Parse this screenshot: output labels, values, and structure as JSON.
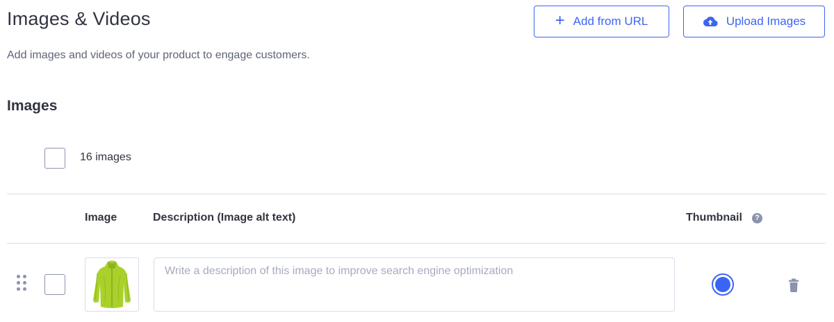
{
  "header": {
    "title": "Images & Videos",
    "subtitle": "Add images and videos of your product to engage customers.",
    "add_from_url_label": "Add from URL",
    "upload_images_label": "Upload Images"
  },
  "images_section": {
    "title": "Images",
    "count_label": "16 images",
    "columns": {
      "image": "Image",
      "description": "Description (Image alt text)",
      "thumbnail": "Thumbnail"
    },
    "rows": [
      {
        "description_value": "",
        "description_placeholder": "Write a description of this image to improve search engine optimization",
        "is_thumbnail": true,
        "selected": false,
        "image_icon": "green-jacket-image"
      }
    ]
  },
  "icons": {
    "add": "plus-icon",
    "upload": "cloud-upload-icon",
    "help": "question-circle-icon",
    "drag": "drag-handle-icon",
    "delete": "trash-icon"
  },
  "colors": {
    "accent": "#3c64f4",
    "text": "#313440",
    "muted": "#5e637a",
    "border": "#d9dce9",
    "icon_gray": "#8c93ad"
  }
}
